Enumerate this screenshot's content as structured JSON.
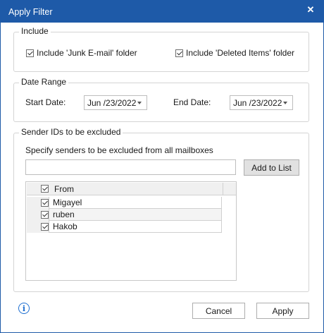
{
  "window": {
    "title": "Apply Filter",
    "close_glyph": "✕"
  },
  "include": {
    "legend": "Include",
    "junk_label": "Include 'Junk E-mail' folder",
    "junk_checked": true,
    "deleted_label": "Include 'Deleted Items' folder",
    "deleted_checked": true
  },
  "date_range": {
    "legend": "Date Range",
    "start_label": "Start Date:",
    "start_value": "Jun /23/2022",
    "end_label": "End Date:",
    "end_value": "Jun /23/2022"
  },
  "sender": {
    "legend": "Sender IDs to be excluded",
    "instruction": "Specify senders to be excluded from all mailboxes",
    "input_value": "",
    "input_placeholder": "",
    "add_button": "Add to List",
    "grid": {
      "header": "From",
      "rows": [
        {
          "name": "Migayel",
          "checked": true
        },
        {
          "name": "ruben",
          "checked": true
        },
        {
          "name": "Hakob",
          "checked": true
        }
      ]
    }
  },
  "footer": {
    "info_glyph": "i",
    "cancel_label": "Cancel",
    "apply_label": "Apply"
  },
  "colors": {
    "titlebar": "#1e5aa8",
    "info_icon": "#1e6fd1"
  }
}
